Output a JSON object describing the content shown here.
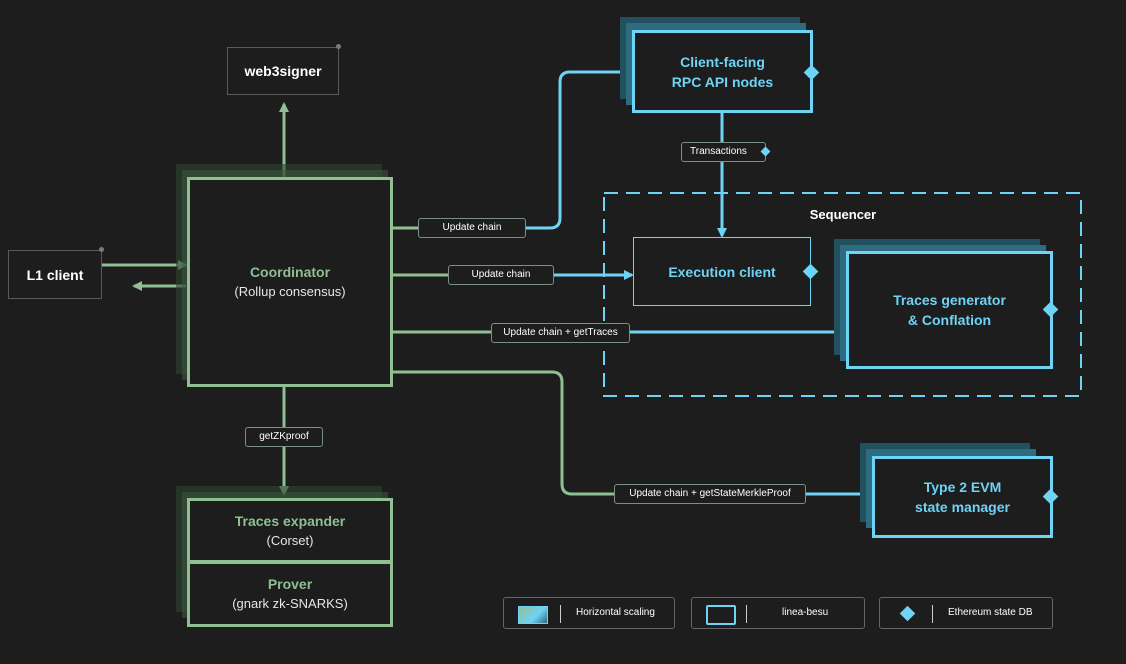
{
  "nodes": {
    "web3signer": "web3signer",
    "l1_client": "L1 client",
    "coordinator_title": "Coordinator",
    "coordinator_sub": "(Rollup consensus)",
    "rpc_line1": "Client-facing",
    "rpc_line2": "RPC API nodes",
    "sequencer": "Sequencer",
    "execution_client": "Execution client",
    "traces_gen_line1": "Traces generator",
    "traces_gen_line2": "& Conflation",
    "type2_line1": "Type 2 EVM",
    "type2_line2": "state manager",
    "traces_expander_title": "Traces expander",
    "traces_expander_sub": "(Corset)",
    "prover_title": "Prover",
    "prover_sub": "(gnark zk-SNARKS)"
  },
  "edge_labels": {
    "transactions": "Transactions",
    "update_chain_rpc": "Update chain",
    "update_chain_exec": "Update chain",
    "update_chain_traces": "Update chain + getTraces",
    "update_chain_state": "Update chain + getStateMerkleProof",
    "get_zk_proof": "getZKproof"
  },
  "legend": {
    "horizontal_scaling": "Horizontal scaling",
    "linea_besu": "linea-besu",
    "ethereum_state_db": "Ethereum state DB"
  },
  "colors": {
    "background": "#1d1d1d",
    "green": "#8fbf93",
    "blue": "#6fd3f5"
  }
}
